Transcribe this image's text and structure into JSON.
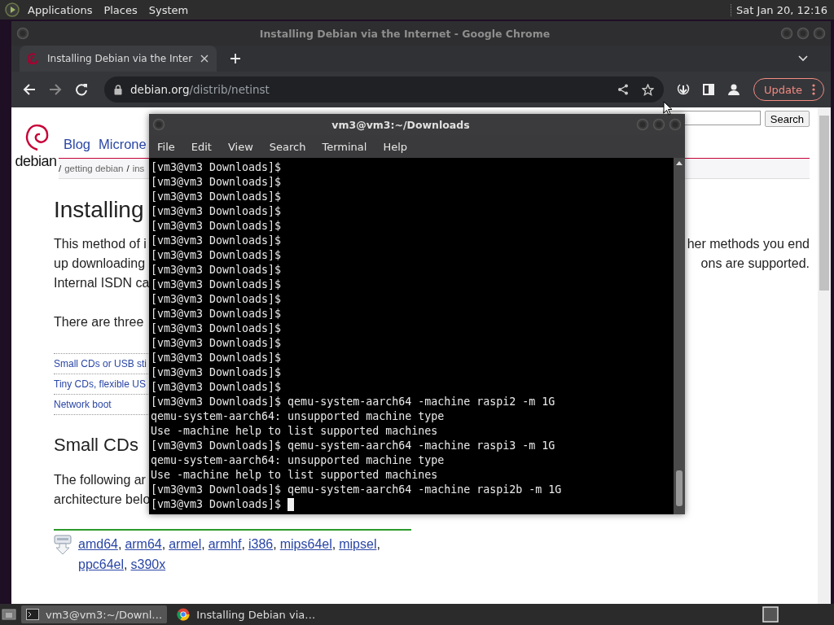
{
  "top_panel": {
    "menus": [
      "Applications",
      "Places",
      "System"
    ],
    "clock": "Sat Jan 20, 12:16"
  },
  "browser": {
    "title": "Installing Debian via the Internet - Google Chrome",
    "tabs": [
      {
        "label": "Installing Debian via the Inter",
        "selected": true
      }
    ],
    "url": {
      "host": "debian.org",
      "path": "/distrib/netinst"
    },
    "update_button": "Update"
  },
  "page": {
    "logo_text": "debian",
    "nav": [
      "Blog",
      "Microne"
    ],
    "breadcrumb": [
      {
        "kind": "sep",
        "text": "/"
      },
      {
        "kind": "link",
        "text": "getting debian"
      },
      {
        "kind": "sep",
        "text": "/"
      },
      {
        "kind": "link",
        "text": "ins"
      }
    ],
    "search_button": "Search",
    "heading": "Installing",
    "paragraph": [
      {
        "left": "This method of i",
        "right": "her methods you end"
      },
      {
        "left": "up downloading",
        "right": "ons are supported."
      },
      {
        "left": "Internal ISDN ca"
      }
    ],
    "intro": "There are three",
    "toc": [
      "Small CDs or USB sti",
      "Tiny CDs, flexible US",
      "Network boot"
    ],
    "section_heading": "Small CDs",
    "section_text": [
      "The following ar",
      "architecture belo"
    ],
    "arch_rows": [
      [
        {
          "label": "amd64",
          "after": ","
        },
        {
          "label": "arm64",
          "after": ","
        },
        {
          "label": "armel",
          "after": ","
        },
        {
          "label": "armhf",
          "after": ","
        },
        {
          "label": "i386",
          "after": ","
        },
        {
          "label": "mips64el",
          "after": ","
        },
        {
          "label": "mipsel",
          "after": ","
        }
      ],
      [
        {
          "label": "ppc64el",
          "after": ","
        },
        {
          "label": "s390x"
        }
      ]
    ]
  },
  "terminal": {
    "title": "vm3@vm3:~/Downloads",
    "menus": [
      "File",
      "Edit",
      "View",
      "Search",
      "Terminal",
      "Help"
    ],
    "lines": [
      "[vm3@vm3 Downloads]$",
      "[vm3@vm3 Downloads]$",
      "[vm3@vm3 Downloads]$",
      "[vm3@vm3 Downloads]$",
      "[vm3@vm3 Downloads]$",
      "[vm3@vm3 Downloads]$",
      "[vm3@vm3 Downloads]$",
      "[vm3@vm3 Downloads]$",
      "[vm3@vm3 Downloads]$",
      "[vm3@vm3 Downloads]$",
      "[vm3@vm3 Downloads]$",
      "[vm3@vm3 Downloads]$",
      "[vm3@vm3 Downloads]$",
      "[vm3@vm3 Downloads]$",
      "[vm3@vm3 Downloads]$",
      "[vm3@vm3 Downloads]$",
      "[vm3@vm3 Downloads]$ qemu-system-aarch64 -machine raspi2 -m 1G",
      "qemu-system-aarch64: unsupported machine type",
      "Use -machine help to list supported machines",
      "[vm3@vm3 Downloads]$ qemu-system-aarch64 -machine raspi3 -m 1G",
      "qemu-system-aarch64: unsupported machine type",
      "Use -machine help to list supported machines",
      "[vm3@vm3 Downloads]$ qemu-system-aarch64 -machine raspi2b -m 1G",
      "[vm3@vm3 Downloads]$"
    ],
    "cursor": true
  },
  "taskbar": {
    "tasks": [
      {
        "kind": "terminal",
        "label": "vm3@vm3:~/Downl…",
        "selected": true
      },
      {
        "kind": "browser",
        "label": "Installing Debian via…",
        "selected": false
      }
    ]
  }
}
